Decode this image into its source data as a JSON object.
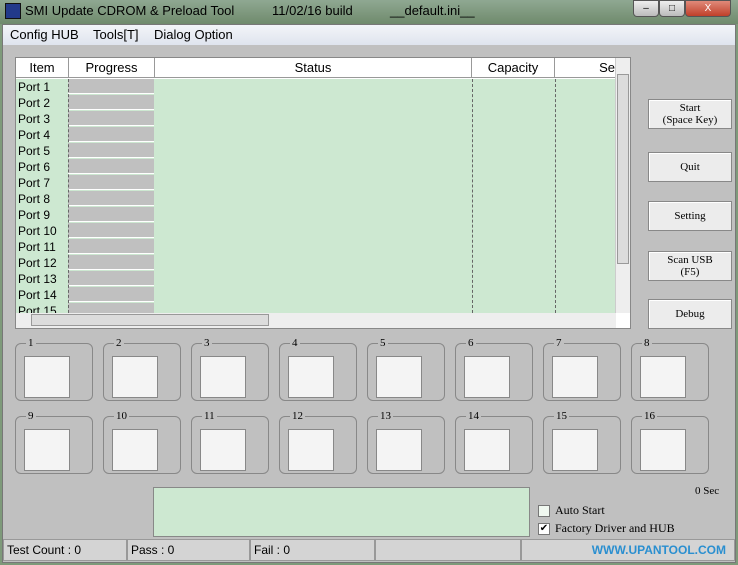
{
  "window": {
    "app_title": "SMI Update CDROM & Preload Tool",
    "build": "11/02/16 build",
    "ini": "__default.ini__",
    "minimize": "–",
    "maximize": "□",
    "close": "X"
  },
  "menu": [
    "Config HUB",
    "Tools[T]",
    "Dialog Option"
  ],
  "grid": {
    "headers": [
      "Item",
      "Progress",
      "Status",
      "Capacity",
      "Se"
    ],
    "rows": [
      "Port 1",
      "Port 2",
      "Port 3",
      "Port 4",
      "Port 5",
      "Port 6",
      "Port 7",
      "Port 8",
      "Port 9",
      "Port 10",
      "Port 11",
      "Port 12",
      "Port 13",
      "Port 14",
      "Port 15"
    ]
  },
  "buttons": [
    "Start\n(Space Key)",
    "Quit",
    "Setting",
    "Scan USB\n(F5)",
    "Debug"
  ],
  "slots": [
    "1",
    "2",
    "3",
    "4",
    "5",
    "6",
    "7",
    "8",
    "9",
    "10",
    "11",
    "12",
    "13",
    "14",
    "15",
    "16"
  ],
  "timer": "0 Sec",
  "options": {
    "auto_start": "Auto Start",
    "auto_start_checked": false,
    "factory": "Factory Driver and HUB",
    "factory_checked": true
  },
  "status": {
    "test_count": "Test Count : 0",
    "pass": "Pass : 0",
    "fail": "Fail : 0"
  },
  "watermark": "WWW.UPANTOOL.COM"
}
